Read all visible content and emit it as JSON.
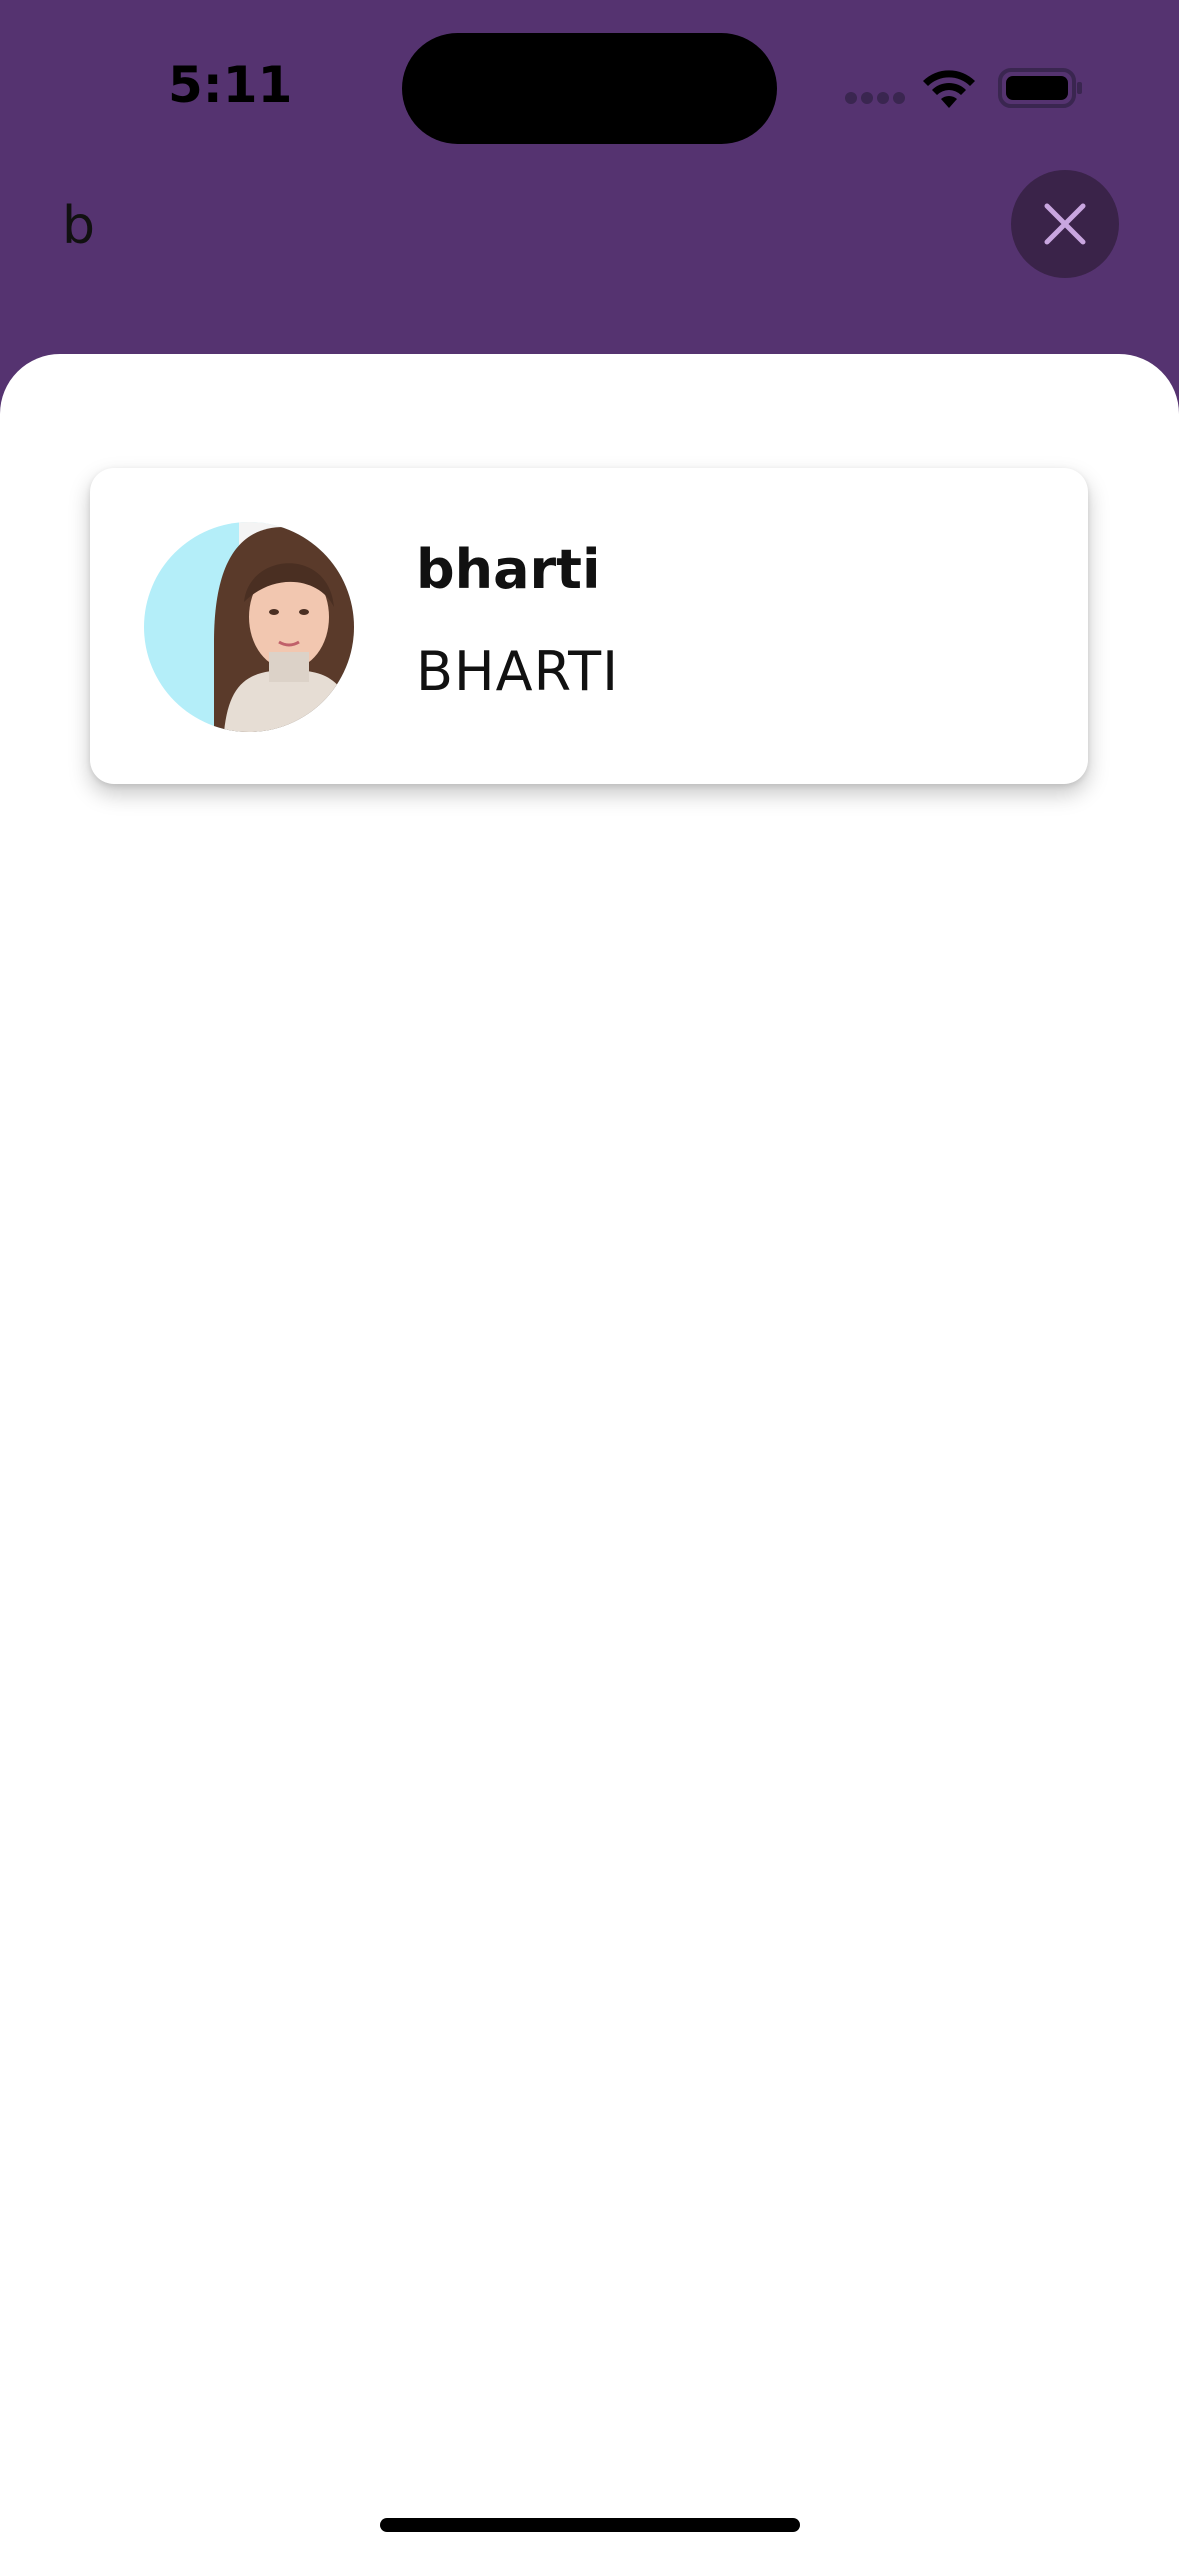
{
  "status_bar": {
    "time": "5:11",
    "icons": [
      "cellular-signal-icon",
      "wifi-icon",
      "battery-icon"
    ]
  },
  "search": {
    "query": "b",
    "close_icon": "close-icon"
  },
  "results": [
    {
      "username": "bharti",
      "display_name": "BHARTI",
      "avatar": "avatar"
    }
  ],
  "colors": {
    "header_bg": "#553370",
    "close_button_bg": "#3a2349",
    "close_icon": "#c9a6e0",
    "sheet_bg": "#ffffff",
    "text": "#111111"
  }
}
